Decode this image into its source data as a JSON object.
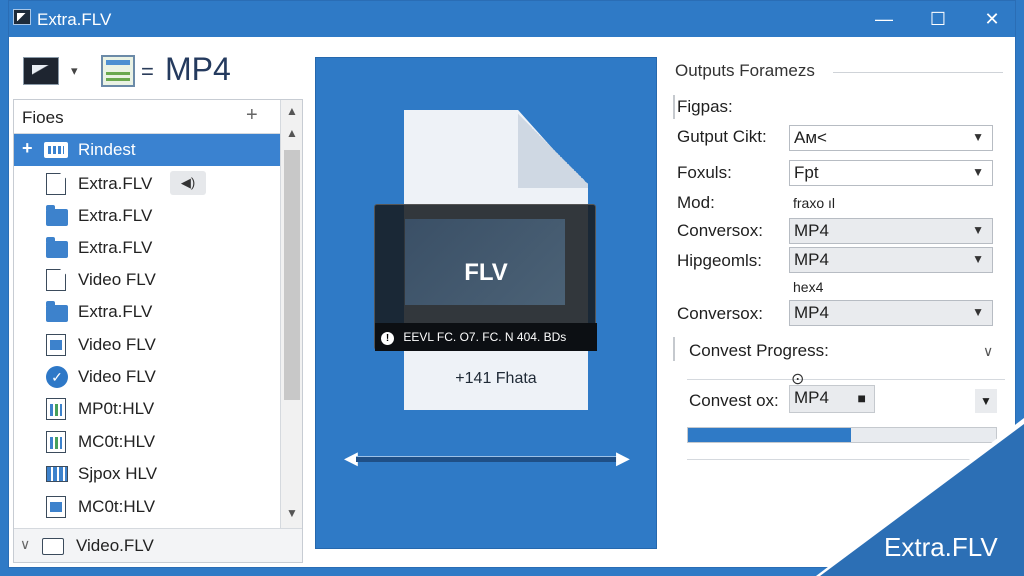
{
  "window": {
    "title": "Extra.FLV",
    "minimize": "—",
    "maximize": "☐",
    "close": "✕"
  },
  "toolbar": {
    "dropdown_glyph": "▾",
    "equals": "=",
    "target_format": "MP4"
  },
  "files": {
    "title": "Fioes",
    "add": "+",
    "items": [
      {
        "label": "Rindest",
        "icon": "network-folder-icon",
        "selected": true
      },
      {
        "label": "Extra.FLV",
        "icon": "document-icon",
        "badge": "◀)"
      },
      {
        "label": "Extra.FLV",
        "icon": "folder-icon"
      },
      {
        "label": "Extra.FLV",
        "icon": "folder-icon"
      },
      {
        "label": "Video FLV",
        "icon": "document-icon"
      },
      {
        "label": "Extra.FLV",
        "icon": "folder-icon"
      },
      {
        "label": "Video FLV",
        "icon": "video-file-icon"
      },
      {
        "label": "Video FLV",
        "icon": "checkmark-icon"
      },
      {
        "label": "MP0t:HLV",
        "icon": "chart-file-icon"
      },
      {
        "label": "MC0t:HLV",
        "icon": "chart-file-icon"
      },
      {
        "label": "Sjpox HLV",
        "icon": "grid-file-icon"
      },
      {
        "label": "MC0t:HLV",
        "icon": "video-file-icon"
      }
    ],
    "footer_label": "Video.FLV",
    "scroll_up": "▲",
    "scroll_down": "▼",
    "footer_chevron": "∨"
  },
  "preview": {
    "overlay_title": "FLV",
    "overlay_info": "EEVL FC. O7. FC. N 404. BDs",
    "info_glyph": "!",
    "caption": "+141 Fhata",
    "arrow_left": "◀",
    "arrow_right": "▶"
  },
  "settings": {
    "title": "Outputs Foramezs",
    "rows": [
      {
        "label": "Figpas:"
      },
      {
        "label": "Gutput Cikt:",
        "value": "Ам<"
      },
      {
        "label": "Foxuls:",
        "value": "Fpt"
      },
      {
        "label": "Mod:",
        "plain": "fraxo ıl"
      },
      {
        "label": "Conversox:",
        "value": "MP4"
      },
      {
        "label": "Hipgeomls:",
        "value": "MP4",
        "sub": "hex4"
      },
      {
        "label": "Conversox:",
        "value": "MP4"
      }
    ],
    "progress_label": "Convest Progress:",
    "progress_chevron": "∨",
    "pin_glyph": "⊙",
    "convert_label": "Convest ox:",
    "convert_value": "MP4",
    "convert_stop": "■",
    "convert_caret": "▼",
    "progress_fraction": 0.53,
    "caret": "▼"
  },
  "brand": {
    "text": "Extra.FLV"
  },
  "colors": {
    "accent": "#2f7ac6",
    "selected_row": "#3a82d0"
  }
}
